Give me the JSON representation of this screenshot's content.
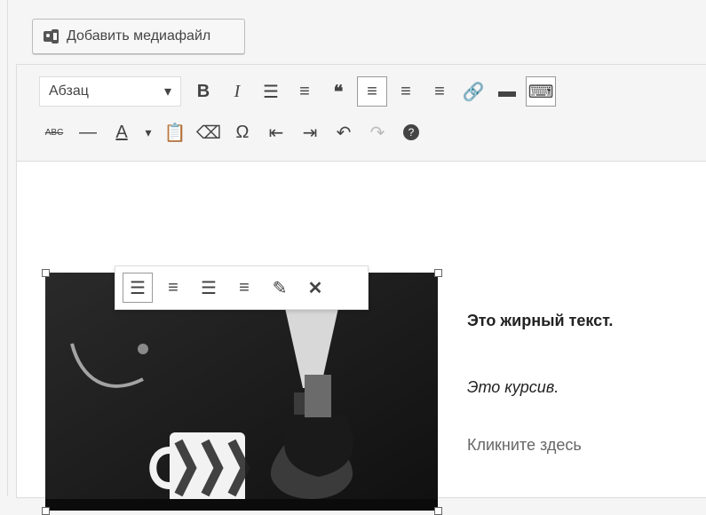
{
  "media_button": {
    "label": "Добавить медиафайл"
  },
  "toolbar": {
    "format_select": "Абзац",
    "row1": [
      "bold",
      "italic",
      "bullet-list",
      "numbered-list",
      "blockquote",
      "align-left",
      "align-center",
      "align-right",
      "link",
      "more",
      "toolbar-toggle"
    ],
    "row2": [
      "strikethrough",
      "horizontal-line",
      "text-color",
      "paste-as-text",
      "clear-formatting",
      "special-character",
      "outdent",
      "indent",
      "undo",
      "redo",
      "help"
    ]
  },
  "content": {
    "bold_text": "Это жирный текст.",
    "italic_text": "Это курсив.",
    "link_text": "Кликните здесь"
  },
  "image_toolbar": [
    "align-left",
    "align-center",
    "align-right",
    "align-none",
    "edit",
    "remove"
  ]
}
